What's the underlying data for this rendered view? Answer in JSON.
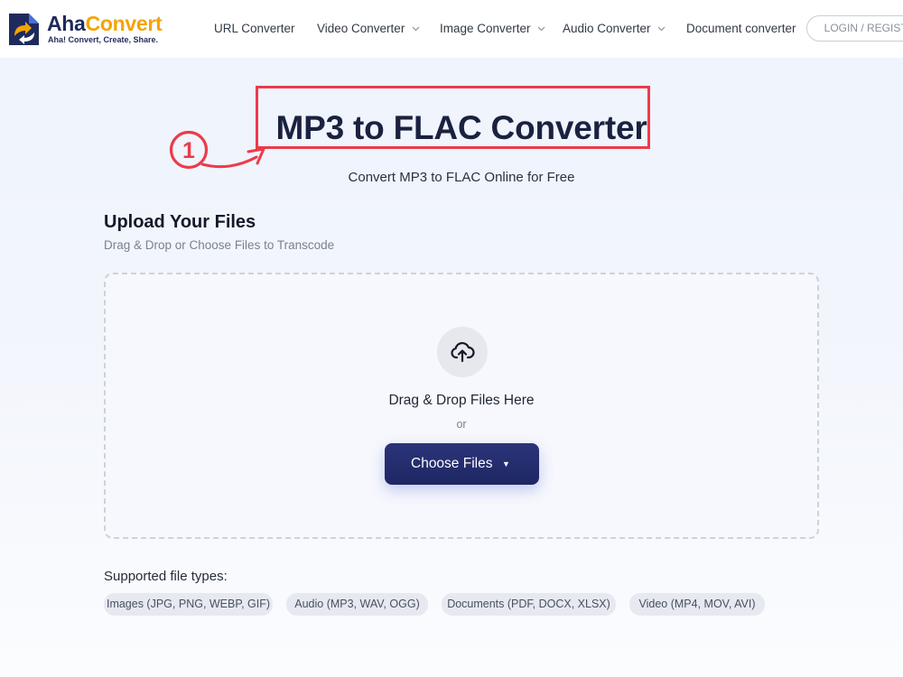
{
  "brand": {
    "name_part1": "Aha",
    "name_part2": "Convert",
    "tagline": "Aha! Convert, Create, Share.",
    "primary_color": "#1f2a5c",
    "accent_color": "#f5a300"
  },
  "nav": {
    "items": [
      {
        "label": "URL Converter",
        "has_dropdown": false
      },
      {
        "label": "Video Converter",
        "has_dropdown": true
      },
      {
        "label": "Image Converter",
        "has_dropdown": true
      },
      {
        "label": "Audio Converter",
        "has_dropdown": true
      },
      {
        "label": "Document converter",
        "has_dropdown": false
      }
    ],
    "login_label": "LOGIN / REGISTER"
  },
  "hero": {
    "title": "MP3 to FLAC Converter",
    "subtitle": "Convert MP3 to FLAC Online for Free",
    "annotation_number": "1",
    "annotation_color": "#ec3b4b"
  },
  "upload": {
    "title": "Upload Your Files",
    "subtitle": "Drag & Drop or Choose Files to Transcode",
    "icon": "cloud-upload-icon",
    "drop_text": "Drag & Drop Files Here",
    "or_text": "or",
    "choose_button": "Choose Files",
    "choose_button_caret": "▼"
  },
  "supported": {
    "title": "Supported file types:",
    "types": [
      "Images (JPG, PNG, WEBP, GIF)",
      "Audio (MP3, WAV, OGG)",
      "Documents (PDF, DOCX, XLSX)",
      "Video (MP4, MOV, AVI)"
    ]
  }
}
